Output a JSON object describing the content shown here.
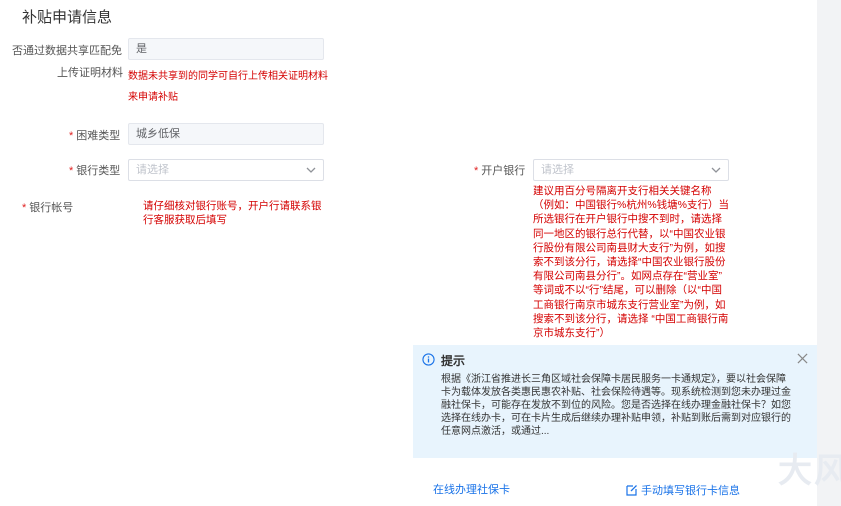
{
  "section_title": "补贴申请信息",
  "form": {
    "shared_match": {
      "label": "否通过数据共享匹配免",
      "value": "是"
    },
    "upload": {
      "label": "上传证明材料",
      "note_line1": "数据未共享到的同学可自行上传相关证明材料",
      "note_line2": "来申请补贴"
    },
    "difficulty": {
      "label": "困难类型",
      "value": "城乡低保"
    },
    "bank_type": {
      "label": "银行类型",
      "placeholder": "请选择"
    },
    "branch_bank": {
      "label": "开户银行",
      "placeholder": "请选择",
      "hint_lines": [
        "建议用百分号隔离开支行相关关键名称",
        "（例如：中国银行%杭州%钱塘%支行）当",
        "所选银行在开户银行中搜不到时，请选择",
        "同一地区的银行总行代替，以“中国农业银",
        "行股份有限公司南县财大支行”为例，如搜",
        "索不到该分行，请选择“中国农业银行股份",
        "有限公司南县分行”。如网点存在“营业室”",
        "等词或不以“行”结尾，可以删除（以“中国",
        "工商银行南京市城东支行营业室”为例，如",
        "搜索不到该分行，请选择 “中国工商银行南",
        "京市城东支行”）"
      ]
    },
    "bank_account": {
      "label": "银行帐号",
      "hint_line1": "请仔细核对银行账号，开户行请联系银",
      "hint_line2": "行客服获取后填写"
    }
  },
  "tip": {
    "title": "提示",
    "body": "根据《浙江省推进长三角区域社会保障卡居民服务一卡通规定》，要以社会保障卡为载体发放各类惠民惠农补贴、社会保险待遇等。现系统检测到您未办理过金融社保卡，可能存在发放不到位的风险。您是否选择在线办理金融社保卡？如您选择在线办卡，可在卡片生成后继续办理补贴申领，补贴到账后需到对应银行的任意网点激活，或通过..."
  },
  "links": {
    "online_card": "在线办理社保卡",
    "manual_bank": "手动填写银行卡信息"
  },
  "watermark": "大风"
}
